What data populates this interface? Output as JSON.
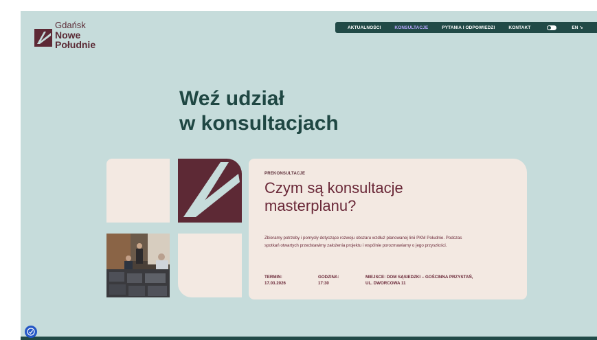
{
  "logo": {
    "line1": "Gdańsk",
    "line2": "Nowe",
    "line3": "Południe"
  },
  "nav": {
    "items": [
      {
        "label": "AKTUALNOŚCI",
        "active": false
      },
      {
        "label": "KONSULTACJE",
        "active": true
      },
      {
        "label": "PYTANIA I ODPOWIEDZI",
        "active": false
      },
      {
        "label": "KONTAKT",
        "active": false
      }
    ],
    "lang": "EN ↘"
  },
  "hero": {
    "line1": "Weź udział",
    "line2": "w konsultacjach"
  },
  "card": {
    "eyebrow": "PREKONSULTACJE",
    "title_line1": "Czym są konsultacje",
    "title_line2": "masterplanu?",
    "description": "Zbieramy potrzeby i pomysły dotyczące rozwoju obszaru wzdłuż planowanej linii PKM Południe. Podczas spotkań otwartych przedstawimy założenia projektu i wspólnie porozmawiamy o jego przyszłości.",
    "termin_label": "TERMIN:",
    "termin_value": "17.03.2026",
    "godzina_label": "GODZINA:",
    "godzina_value": "17:30",
    "miejsce_label": "MIEJSCE: DOM SĄSIEDZKI – GOŚCINNA PRZYSTAŃ,",
    "miejsce_value": "UL. DWORCOWA 11"
  },
  "colors": {
    "background": "#c6dcdb",
    "nav_bg": "#214a47",
    "nav_active": "#b9a8ff",
    "maroon": "#5d2935",
    "cream": "#f3e9e2",
    "heading": "#1f4743"
  },
  "icons": {
    "logo": "logo-mark-icon",
    "toggle": "theme-toggle-icon",
    "accessibility": "accessibility-icon"
  }
}
